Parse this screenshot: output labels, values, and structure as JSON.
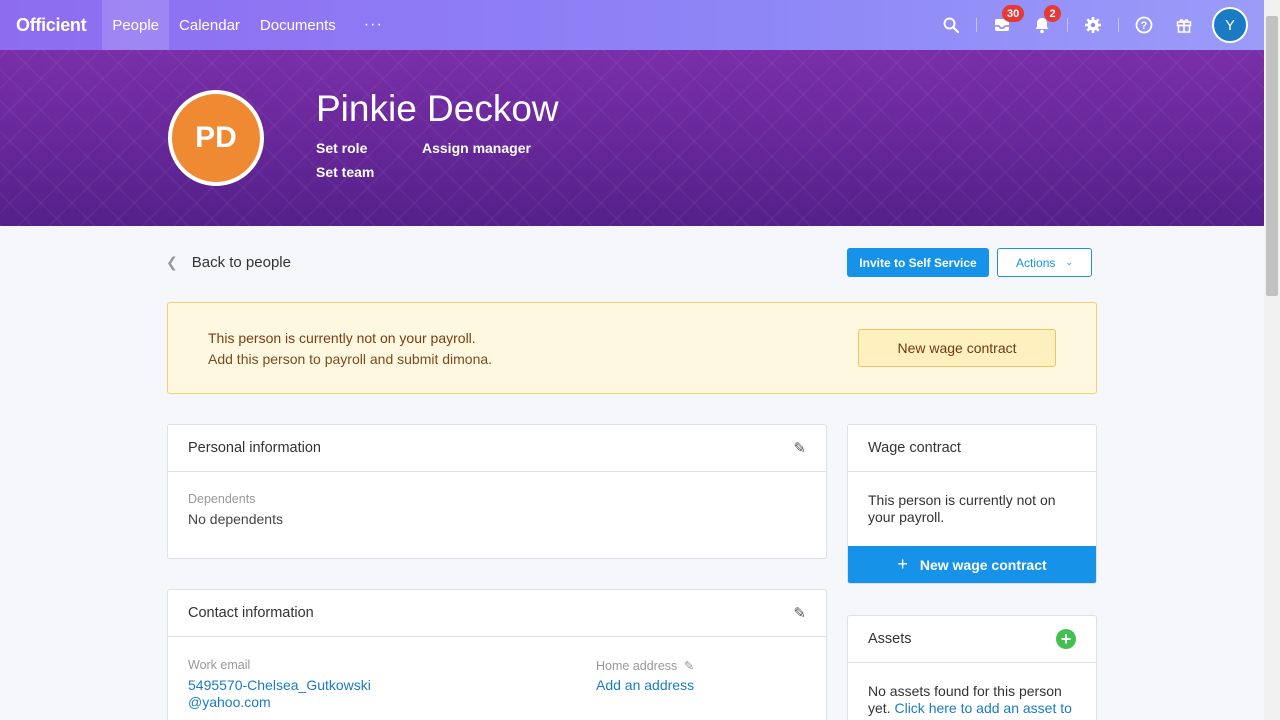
{
  "nav": {
    "logo": "Officient",
    "links": [
      "People",
      "Calendar",
      "Documents"
    ],
    "more": "···",
    "inbox_badge": "30",
    "notif_badge": "2",
    "user_initial": "Y"
  },
  "hero": {
    "initials": "PD",
    "name": "Pinkie Deckow",
    "set_role": "Set role",
    "assign_manager": "Assign manager",
    "set_team": "Set team"
  },
  "toolbar": {
    "back": "Back to people",
    "invite": "Invite to Self Service",
    "actions": "Actions"
  },
  "alert": {
    "title": "This person is currently not on your payroll.",
    "subtitle": "Add this person to payroll and submit dimona.",
    "button": "New wage contract"
  },
  "personal": {
    "title": "Personal information",
    "dependents_label": "Dependents",
    "dependents_value": "No dependents"
  },
  "contact": {
    "title": "Contact information",
    "work_email_label": "Work email",
    "work_email_line1": "5495570-Chelsea_Gutkowski",
    "work_email_line2": "@yahoo.com",
    "home_address_label": "Home address",
    "home_address_link": "Add an address"
  },
  "wage": {
    "title": "Wage contract",
    "text": "This person is currently not on your payroll.",
    "button": "New wage contract"
  },
  "assets": {
    "title": "Assets",
    "text": "No assets found for this person yet.",
    "link": "Click here to add an asset to"
  }
}
